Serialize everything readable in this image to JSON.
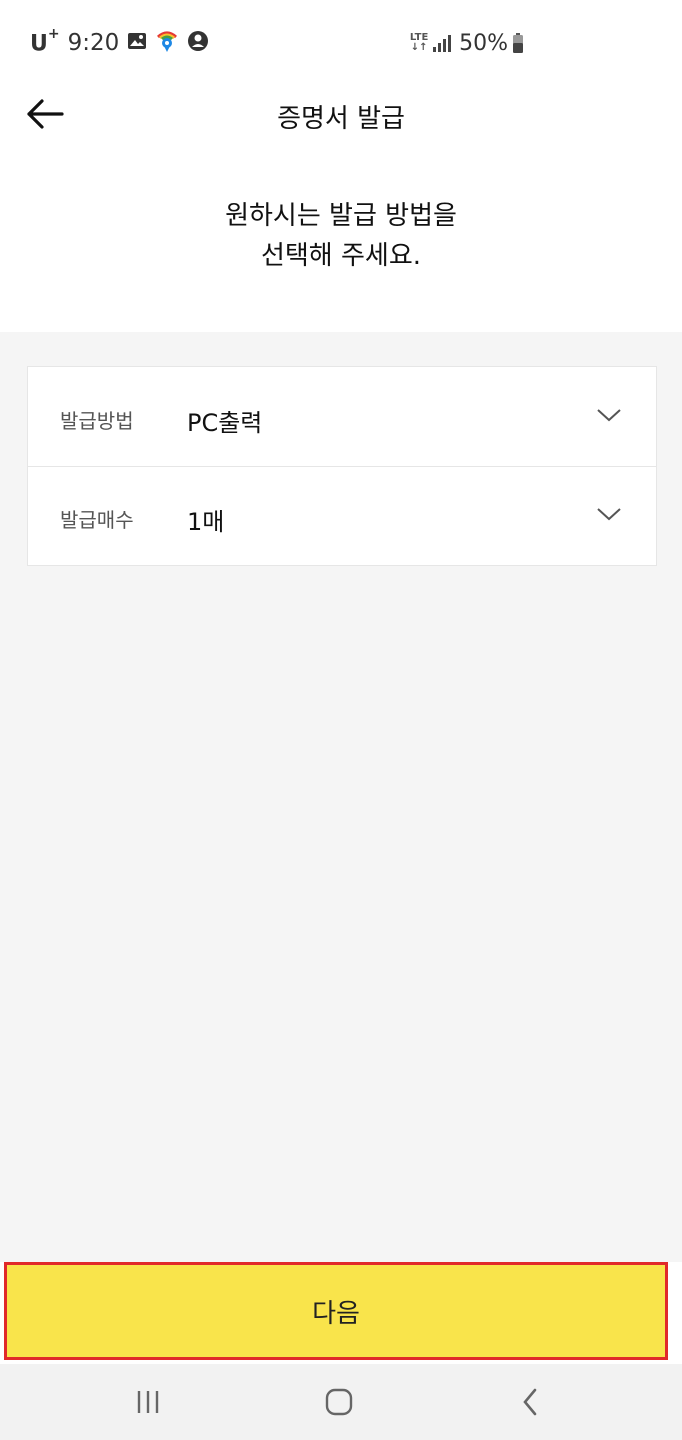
{
  "status_bar": {
    "carrier": "U",
    "carrier_sup": "+",
    "time": "9:20",
    "network": "LTE",
    "battery": "50%"
  },
  "header": {
    "title": "증명서 발급"
  },
  "intro": {
    "line1": "원하시는 발급 방법을",
    "line2": "선택해 주세요."
  },
  "form": {
    "rows": [
      {
        "label": "발급방법",
        "value": "PC출력"
      },
      {
        "label": "발급매수",
        "value": "1매"
      }
    ]
  },
  "next_button": {
    "label": "다음"
  },
  "colors": {
    "accent": "#f9e44b",
    "highlight_border": "#e02a2a",
    "background": "#f5f5f5"
  }
}
